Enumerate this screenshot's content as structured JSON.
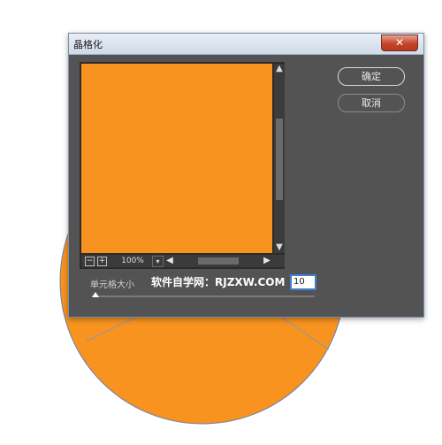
{
  "colors": {
    "canvas_fill": "#f7931e",
    "dialog_bg": "#535353",
    "input_border": "#3f7fd0"
  },
  "dialog": {
    "title": "晶格化",
    "close_icon": "close-icon",
    "ok_label": "确定",
    "cancel_label": "取消"
  },
  "preview": {
    "zoom_out_icon": "zoom-out-icon",
    "zoom_in_icon": "zoom-in-icon",
    "zoom_out_glyph": "−",
    "zoom_in_glyph": "+",
    "zoom_level": "100%"
  },
  "options": {
    "cell_size_label": "单元格大小",
    "cell_size_value": "10",
    "slider_value_fraction": 0.0
  },
  "watermark": "软件自学网：RJZXW.COM"
}
